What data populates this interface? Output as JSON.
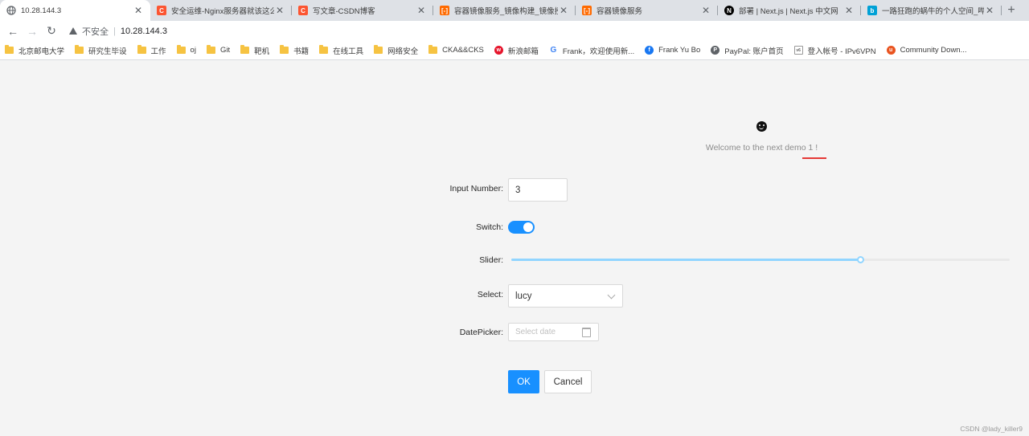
{
  "tabs": [
    {
      "title": "10.28.144.3",
      "icon": "globe-icon",
      "active": true
    },
    {
      "title": "安全运维-Nginx服务器就该这么",
      "icon": "csdn-icon"
    },
    {
      "title": "写文章-CSDN博客",
      "icon": "csdn-icon"
    },
    {
      "title": "容器镜像服务_镜像构建_镜像授权",
      "icon": "aliyun-icon"
    },
    {
      "title": "容器镜像服务",
      "icon": "aliyun-icon"
    },
    {
      "title": "部署 | Next.js | Next.js 中文网",
      "icon": "nextjs-icon"
    },
    {
      "title": "一路狂跑的蜗牛的个人空间_哔哩",
      "icon": "bilibili-icon"
    }
  ],
  "toolbar": {
    "security_label": "不安全",
    "url": "10.28.144.3"
  },
  "bookmarks": [
    {
      "label": "北京邮电大学",
      "icon": "folder-icon"
    },
    {
      "label": "研究生毕设",
      "icon": "folder-icon"
    },
    {
      "label": "工作",
      "icon": "folder-icon"
    },
    {
      "label": "oj",
      "icon": "folder-icon"
    },
    {
      "label": "Git",
      "icon": "folder-icon"
    },
    {
      "label": "靶机",
      "icon": "folder-icon"
    },
    {
      "label": "书籍",
      "icon": "folder-icon"
    },
    {
      "label": "在线工具",
      "icon": "folder-icon"
    },
    {
      "label": "网络安全",
      "icon": "folder-icon"
    },
    {
      "label": "CKA&&CKS",
      "icon": "folder-icon"
    },
    {
      "label": "新浪邮箱",
      "icon": "weibo-icon"
    },
    {
      "label": "Frank，欢迎使用新...",
      "icon": "google-icon"
    },
    {
      "label": "Frank Yu Bo",
      "icon": "facebook-icon"
    },
    {
      "label": "PayPal: 账户首页",
      "icon": "paypal-icon"
    },
    {
      "label": "登入帐号 - IPv6VPN",
      "icon": "ipv6-icon"
    },
    {
      "label": "Community Down...",
      "icon": "ubuntu-icon"
    }
  ],
  "page": {
    "welcome": "Welcome to the next demo 1 !",
    "form": {
      "input_number_label": "Input Number",
      "input_number_value": "3",
      "switch_label": "Switch",
      "switch_on": true,
      "slider_label": "Slider",
      "slider_value_fraction": 0.7,
      "select_label": "Select",
      "select_value": "lucy",
      "datepicker_label": "DatePicker",
      "datepicker_placeholder": "Select date",
      "ok_label": "OK",
      "cancel_label": "Cancel"
    },
    "colors": {
      "primary": "#1890ff",
      "slider": "#91d5ff",
      "accent_red": "#e53935"
    }
  },
  "watermark": "CSDN @lady_killer9"
}
